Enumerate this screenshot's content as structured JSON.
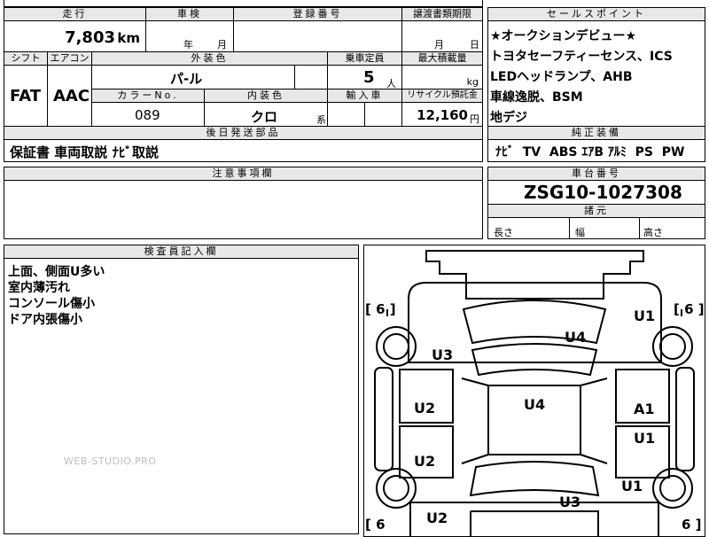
{
  "top": {
    "mileage_header": "走行",
    "mileage_value": "7,803",
    "mileage_unit": "km",
    "inspection_header": "車検",
    "inspection_year": "年",
    "inspection_month": "月",
    "registration_header": "登録番号",
    "transfer_deadline_header": "譲渡書類期限",
    "transfer_month": "月",
    "transfer_day": "日"
  },
  "row2": {
    "shift_header": "シフト",
    "shift_value": "FAT",
    "ac_header": "エアコン",
    "ac_value": "AAC",
    "exterior_color_header": "外装色",
    "exterior_color_value": "パ-ル",
    "capacity_header": "乗車定員",
    "capacity_value": "5",
    "capacity_unit": "人",
    "max_load_header": "最大積載量",
    "max_load_unit": "kg",
    "color_no_header": "カラーNo.",
    "color_no_value": "089",
    "interior_color_header": "内装色",
    "interior_color_value": "クロ",
    "interior_suffix": "系",
    "import_header": "輸入車",
    "recycle_header": "リサイクル預託金",
    "recycle_value": "12,160",
    "recycle_unit": "円"
  },
  "later_parts": {
    "header": "後日発送部品",
    "value": "保証書 車両取説 ﾅﾋﾞ取説"
  },
  "notes": {
    "header": "注意事項欄"
  },
  "inspector": {
    "header": "検査員記入欄",
    "lines": [
      "上面、側面U多い",
      "室内薄汚れ",
      "コンソール傷小",
      "ドア内張傷小"
    ]
  },
  "sales_points": {
    "header": "セールスポイント",
    "lines": [
      "★オークションデビュー★",
      "トヨタセーフティーセンス、ICS",
      "LEDヘッドランプ、AHB",
      "車線逸脱、BSM",
      "地デジ"
    ]
  },
  "equipment": {
    "header": "純正装備",
    "value": "ﾅﾋﾞ  TV  ABS ｴｱB ｱﾙﾐ  PS  PW"
  },
  "chassis": {
    "header": "車台番号",
    "value": "ZSG10-1027308"
  },
  "dimensions": {
    "header": "諸元",
    "length": "長さ",
    "width": "幅",
    "height": "高さ"
  },
  "diagram": {
    "labels": {
      "front_right": "U1",
      "hood": "U4",
      "front_left": "U3",
      "roof": "U4",
      "left_front_door": "U2",
      "right_front_door": "A1",
      "left_rear_door": "U2",
      "right_rear_door": "U1",
      "right_rear_quarter": "U1",
      "trunk": "U3",
      "left_rear_quarter": "U2"
    },
    "brackets": [
      "[ 6 ]",
      "[ 6 ]",
      "[ 6",
      "6 ]"
    ]
  },
  "watermark": "WEB-STUDIO.PRO"
}
